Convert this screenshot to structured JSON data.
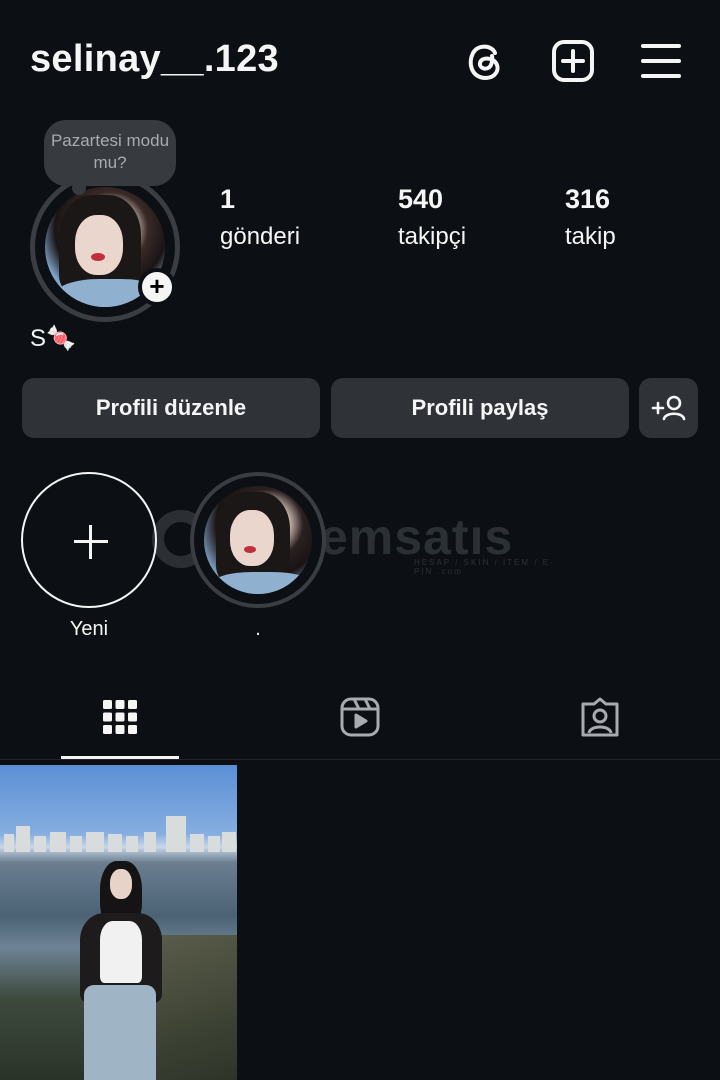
{
  "header": {
    "username": "selinay__.123",
    "icons": [
      "threads-icon",
      "create-post-icon",
      "menu-icon"
    ]
  },
  "profile": {
    "note": "Pazartesi modu mu?",
    "bio": "S🍬",
    "stats": [
      {
        "value": "1",
        "label": "gönderi"
      },
      {
        "value": "540",
        "label": "takipçi"
      },
      {
        "value": "316",
        "label": "takip"
      }
    ]
  },
  "actions": {
    "edit_label": "Profili düzenle",
    "share_label": "Profili paylaş"
  },
  "highlights": [
    {
      "label": "Yeni"
    },
    {
      "label": "."
    }
  ],
  "watermark": {
    "text": "emsatıs",
    "sub": "HESAP / SKIN / ITEM / E-PIN",
    "domain": ".com"
  },
  "tabs": [
    "grid-tab",
    "reels-tab",
    "tagged-tab"
  ],
  "colors": {
    "background": "#0c1014",
    "button": "#2f3237",
    "text": "#f5f5f5"
  }
}
